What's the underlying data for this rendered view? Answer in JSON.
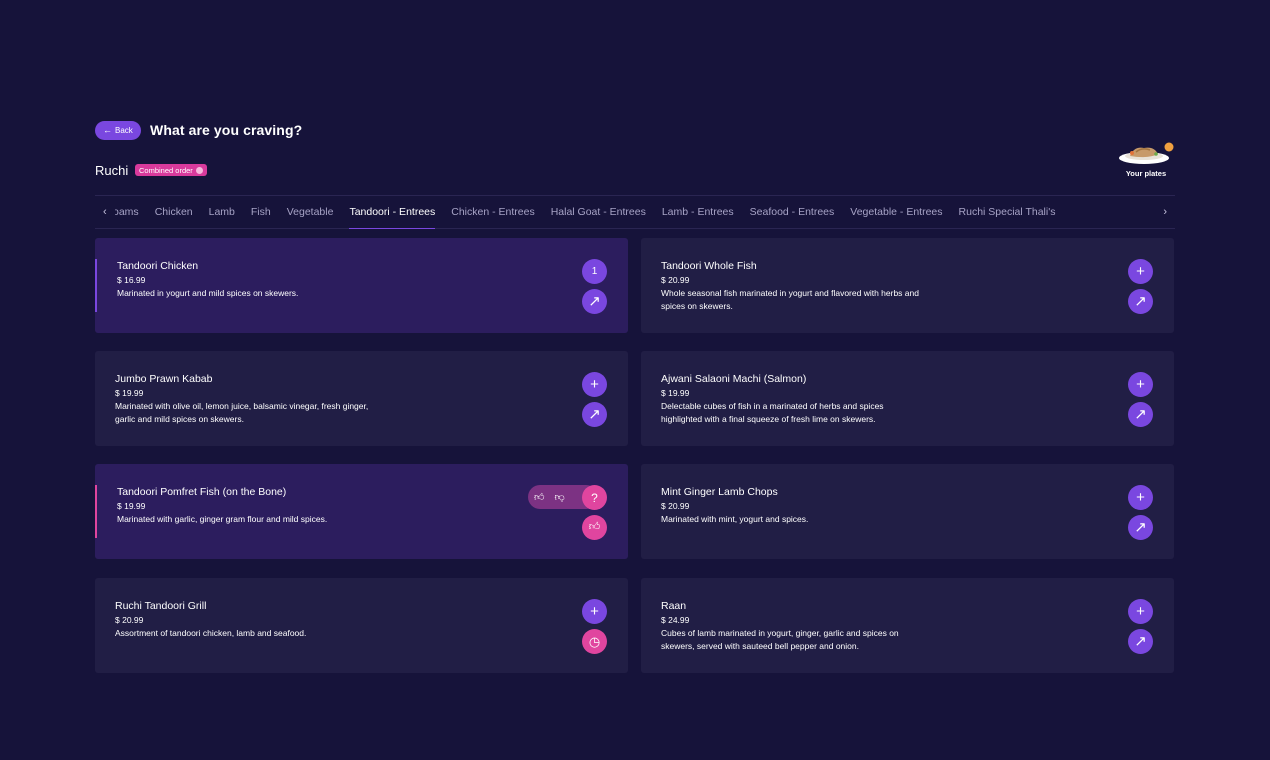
{
  "header": {
    "back_label": "Back",
    "title": "What are you craving?",
    "restaurant": "Ruchi",
    "order_badge": "Combined order"
  },
  "plates": {
    "label": "Your plates"
  },
  "tabs": [
    "oams",
    "Chicken",
    "Lamb",
    "Fish",
    "Vegetable",
    "Tandoori - Entrees",
    "Chicken - Entrees",
    "Halal Goat - Entrees",
    "Lamb - Entrees",
    "Seafood - Entrees",
    "Vegetable - Entrees",
    "Ruchi Special Thali's"
  ],
  "active_tab": "Tandoori - Entrees",
  "colors": {
    "accent": "#7a47e0",
    "pink": "#e0459f",
    "background": "#16133a",
    "card": "#211e45"
  },
  "items": [
    {
      "name": "Tandoori Chicken",
      "price": "$ 16.99",
      "desc": "Marinated in yogurt and mild spices on skewers.",
      "count": "1"
    },
    {
      "name": "Tandoori Whole Fish",
      "price": "$ 20.99",
      "desc1": "Whole seasonal fish marinated in yogurt and flavored with herbs and",
      "desc2": "spices on skewers."
    },
    {
      "name": "Jumbo Prawn Kabab",
      "price": "$ 19.99",
      "desc1": "Marinated with olive oil, lemon juice, balsamic vinegar, fresh ginger,",
      "desc2": "garlic and mild spices on skewers."
    },
    {
      "name": "Ajwani Salaoni Machi (Salmon)",
      "price": "$ 19.99",
      "desc1": "Delectable cubes of fish in a marinated of herbs and spices",
      "desc2": "highlighted with a final squeeze of fresh lime on skewers."
    },
    {
      "name": "Tandoori Pomfret Fish (on the Bone)",
      "price": "$ 19.99",
      "desc": "Marinated with garlic, ginger gram flour and mild spices."
    },
    {
      "name": "Mint Ginger Lamb Chops",
      "price": "$ 20.99",
      "desc": "Marinated with mint, yogurt and spices."
    },
    {
      "name": "Ruchi Tandoori Grill",
      "price": "$ 20.99",
      "desc": "Assortment of tandoori chicken, lamb and seafood."
    },
    {
      "name": "Raan",
      "price": "$ 24.99",
      "desc1": "Cubes of lamb marinated in yogurt, ginger, garlic and spices on",
      "desc2": "skewers, served with sauteed bell pepper and onion."
    }
  ]
}
